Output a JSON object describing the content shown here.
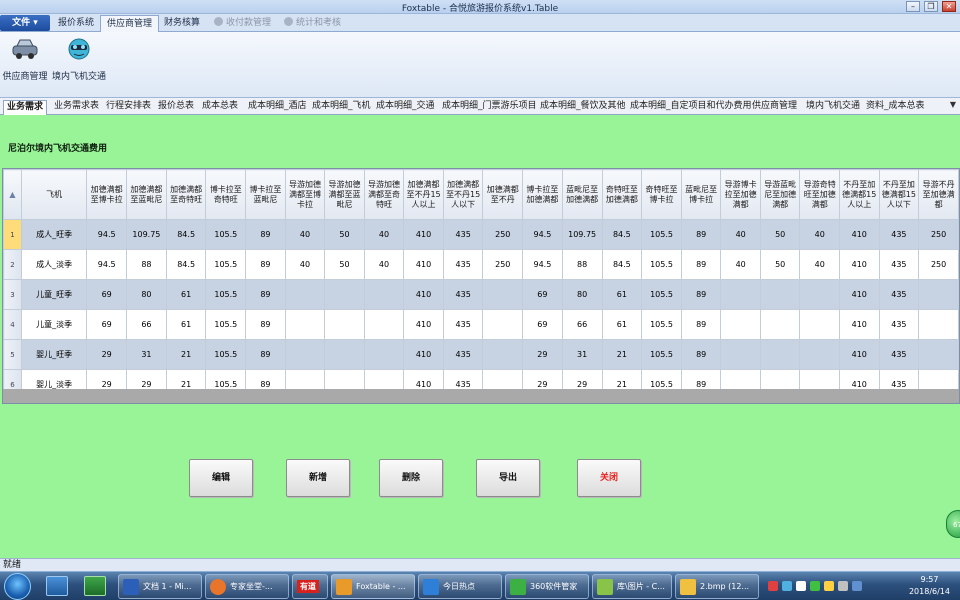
{
  "window": {
    "title": "Foxtable - 合悦旅游报价系统v1.Table"
  },
  "ribbon_tabs": {
    "file": "文件",
    "tabs": [
      "报价系统",
      "供应商管理",
      "财务核算",
      "收付款管理",
      "统计和考核"
    ]
  },
  "ribbon_buttons": [
    "供应商管理",
    "境内飞机交通"
  ],
  "module_tabs": [
    "业务需求",
    "业务需求表",
    "行程安排表",
    "报价总表",
    "成本总表",
    "成本明细_酒店",
    "成本明细_飞机",
    "成本明细_交通",
    "成本明细_门票游乐项目",
    "成本明细_餐饮及其他",
    "成本明细_自定项目和代办费用",
    "供应商管理",
    "境内飞机交通",
    "资料_成本总表"
  ],
  "section_title": "尼泊尔境内飞机交通费用",
  "grid": {
    "corner": "▲",
    "columns": [
      "飞机",
      "加德满都至博卡拉",
      "加德满都至蓝毗尼",
      "加德满都至奇特旺",
      "博卡拉至奇特旺",
      "博卡拉至蓝毗尼",
      "导游加德满都至博卡拉",
      "导游加德满都至蓝毗尼",
      "导游加德满都至奇特旺",
      "加德满都至不丹15人以上",
      "加德满都至不丹15人以下",
      "加德满都至不丹",
      "博卡拉至加德满都",
      "蓝毗尼至加德满都",
      "奇特旺至加德满都",
      "奇特旺至博卡拉",
      "蓝毗尼至博卡拉",
      "导游博卡拉至加德满都",
      "导游蓝毗尼至加德满都",
      "导游奇特旺至加德满都",
      "不丹至加德满都15人以上",
      "不丹至加德满都15人以下",
      "导游不丹至加德满都"
    ],
    "rows": [
      [
        "1",
        "成人_旺季",
        "94.5",
        "109.75",
        "84.5",
        "105.5",
        "89",
        "40",
        "50",
        "40",
        "410",
        "435",
        "250",
        "94.5",
        "109.75",
        "84.5",
        "105.5",
        "89",
        "40",
        "50",
        "40",
        "410",
        "435",
        "250"
      ],
      [
        "2",
        "成人_淡季",
        "94.5",
        "88",
        "84.5",
        "105.5",
        "89",
        "40",
        "50",
        "40",
        "410",
        "435",
        "250",
        "94.5",
        "88",
        "84.5",
        "105.5",
        "89",
        "40",
        "50",
        "40",
        "410",
        "435",
        "250"
      ],
      [
        "3",
        "儿童_旺季",
        "69",
        "80",
        "61",
        "105.5",
        "89",
        "",
        "",
        "",
        "410",
        "435",
        "",
        "69",
        "80",
        "61",
        "105.5",
        "89",
        "",
        "",
        "",
        "410",
        "435",
        ""
      ],
      [
        "4",
        "儿童_淡季",
        "69",
        "66",
        "61",
        "105.5",
        "89",
        "",
        "",
        "",
        "410",
        "435",
        "",
        "69",
        "66",
        "61",
        "105.5",
        "89",
        "",
        "",
        "",
        "410",
        "435",
        ""
      ],
      [
        "5",
        "婴儿_旺季",
        "29",
        "31",
        "21",
        "105.5",
        "89",
        "",
        "",
        "",
        "410",
        "435",
        "",
        "29",
        "31",
        "21",
        "105.5",
        "89",
        "",
        "",
        "",
        "410",
        "435",
        ""
      ],
      [
        "6",
        "婴儿_淡季",
        "29",
        "29",
        "21",
        "105.5",
        "89",
        "",
        "",
        "",
        "410",
        "435",
        "",
        "29",
        "29",
        "21",
        "105.5",
        "89",
        "",
        "",
        "",
        "410",
        "435",
        ""
      ]
    ]
  },
  "actions": {
    "edit": "编辑",
    "add": "新增",
    "delete": "删除",
    "export": "导出",
    "close": "关闭"
  },
  "float_badge": "67",
  "status": {
    "text": "就绪"
  },
  "taskbar": {
    "tasks": [
      "文档 1 - Mi...",
      "专家坐堂-...",
      "有道",
      "Foxtable - ...",
      "今日热点",
      "360软件管家",
      "库\\图片 - C...",
      "2.bmp (12..."
    ],
    "clock_time": "9:57",
    "clock_date": "2018/6/14"
  },
  "colors": {
    "content_bg": "#98f497",
    "row_alt": "#c7d2e2",
    "close_text": "#e82020"
  }
}
